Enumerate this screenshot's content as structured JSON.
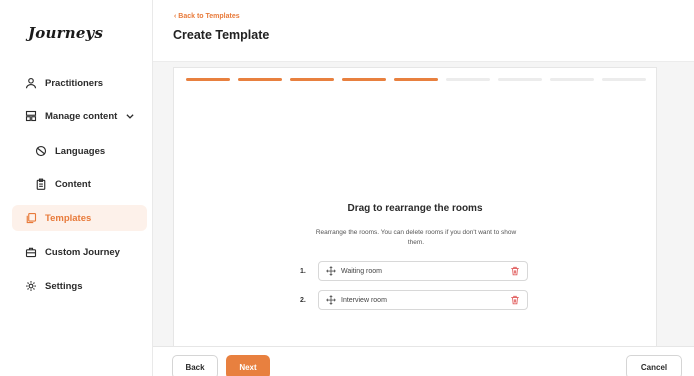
{
  "app": {
    "logo": "Journeys"
  },
  "sidebar": {
    "items": [
      {
        "label": "Practitioners",
        "icon": "people-icon"
      },
      {
        "label": "Manage content",
        "icon": "content-grid-icon"
      },
      {
        "label": "Languages",
        "icon": "globe-icon"
      },
      {
        "label": "Content",
        "icon": "clipboard-icon"
      },
      {
        "label": "Templates",
        "icon": "copy-icon",
        "active": true
      },
      {
        "label": "Custom Journey",
        "icon": "briefcase-icon"
      },
      {
        "label": "Settings",
        "icon": "gear-icon"
      }
    ]
  },
  "header": {
    "back_label": "‹ Back to Templates",
    "title": "Create Template"
  },
  "wizard": {
    "total_steps": 9,
    "completed_steps": 5,
    "title": "Drag to rearrange the rooms",
    "description": "Rearrange the rooms. You can delete rooms if you don't want to show them.",
    "rooms": [
      {
        "number": "1.",
        "label": "Waiting room"
      },
      {
        "number": "2.",
        "label": "Interview room"
      }
    ]
  },
  "footer": {
    "back_label": "Back",
    "next_label": "Next",
    "cancel_label": "Cancel"
  },
  "colors": {
    "accent": "#e8803f",
    "active_bg": "#fdf1ea"
  }
}
